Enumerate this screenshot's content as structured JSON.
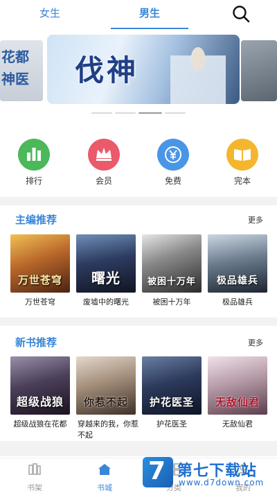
{
  "header": {
    "tabs": [
      {
        "label": "女生"
      },
      {
        "label": "男生"
      }
    ],
    "active_tab": "男生",
    "search_icon": "search-icon"
  },
  "banner": {
    "main_title": "伐神",
    "side_left_text": [
      "花都",
      "神医"
    ]
  },
  "categories": [
    {
      "label": "排行",
      "icon": "ranking-icon",
      "color": "#4cb85a"
    },
    {
      "label": "会员",
      "icon": "crown-icon",
      "color": "#ea5a6b"
    },
    {
      "label": "免费",
      "icon": "yuan-icon",
      "color": "#4a96e6"
    },
    {
      "label": "完本",
      "icon": "book-icon",
      "color": "#f3b62e"
    }
  ],
  "sections": [
    {
      "title": "主编推荐",
      "more": "更多",
      "books": [
        {
          "title": "万世苍穹",
          "cover_text": "万世苍穹"
        },
        {
          "title": "废墟中的曙光",
          "cover_text": "曙光"
        },
        {
          "title": "被困十万年",
          "cover_text": "被困十万年"
        },
        {
          "title": "极品雄兵",
          "cover_text": "极品雄兵"
        }
      ]
    },
    {
      "title": "新书推荐",
      "more": "更多",
      "books": [
        {
          "title": "超级战狼在花都",
          "cover_text": "超级战狼"
        },
        {
          "title": "穿越来的我，你惹不起",
          "cover_text": "你惹不起"
        },
        {
          "title": "护花医圣",
          "cover_text": "护花医圣"
        },
        {
          "title": "无敌仙君",
          "cover_text": "无敌仙君"
        }
      ]
    }
  ],
  "bottom_nav": [
    {
      "label": "书架",
      "icon": "bookshelf-icon"
    },
    {
      "label": "书城",
      "icon": "store-icon",
      "active": true
    },
    {
      "label": "分类",
      "icon": "category-icon"
    },
    {
      "label": "我的",
      "icon": "profile-icon"
    }
  ],
  "watermark": {
    "logo_char": "7",
    "title": "第七下载站",
    "url": "www.d7down.com"
  },
  "colors": {
    "accent": "#3a86d8",
    "section_gap": "#f2f2f2"
  }
}
